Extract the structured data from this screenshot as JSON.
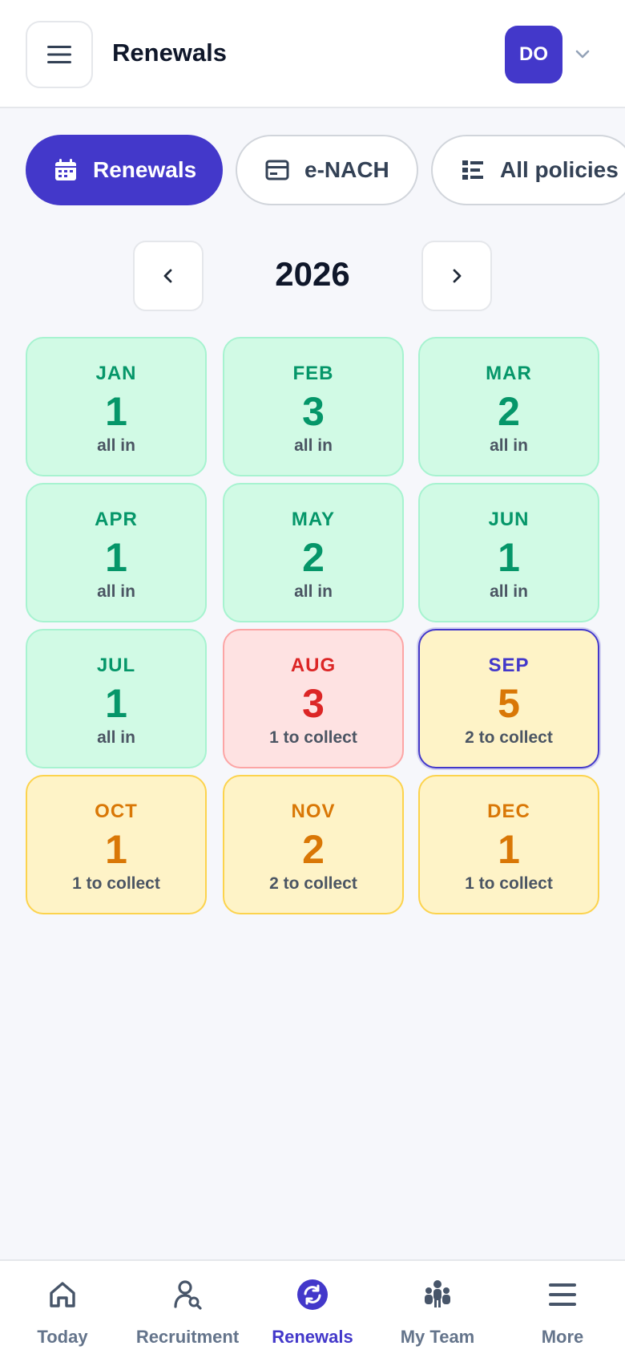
{
  "header": {
    "title": "Renewals",
    "avatar_initials": "DO"
  },
  "tabs": [
    {
      "label": "Renewals",
      "icon": "calendar-icon",
      "active": true
    },
    {
      "label": "e-NACH",
      "icon": "wallet-icon",
      "active": false
    },
    {
      "label": "All policies",
      "icon": "list-icon",
      "active": false
    }
  ],
  "year": "2026",
  "months": [
    {
      "name": "JAN",
      "count": "1",
      "status": "all in",
      "state": "green"
    },
    {
      "name": "FEB",
      "count": "3",
      "status": "all in",
      "state": "green"
    },
    {
      "name": "MAR",
      "count": "2",
      "status": "all in",
      "state": "green"
    },
    {
      "name": "APR",
      "count": "1",
      "status": "all in",
      "state": "green"
    },
    {
      "name": "MAY",
      "count": "2",
      "status": "all in",
      "state": "green"
    },
    {
      "name": "JUN",
      "count": "1",
      "status": "all in",
      "state": "green"
    },
    {
      "name": "JUL",
      "count": "1",
      "status": "all in",
      "state": "green"
    },
    {
      "name": "AUG",
      "count": "3",
      "status": "1 to collect",
      "state": "red"
    },
    {
      "name": "SEP",
      "count": "5",
      "status": "2 to collect",
      "state": "amber",
      "selected": true
    },
    {
      "name": "OCT",
      "count": "1",
      "status": "1 to collect",
      "state": "amber"
    },
    {
      "name": "NOV",
      "count": "2",
      "status": "2 to collect",
      "state": "amber"
    },
    {
      "name": "DEC",
      "count": "1",
      "status": "1 to collect",
      "state": "amber"
    }
  ],
  "bottom_nav": [
    {
      "label": "Today",
      "icon": "home-icon",
      "active": false
    },
    {
      "label": "Recruitment",
      "icon": "user-search-icon",
      "active": false
    },
    {
      "label": "Renewals",
      "icon": "renew-icon",
      "active": true
    },
    {
      "label": "My Team",
      "icon": "team-icon",
      "active": false
    },
    {
      "label": "More",
      "icon": "menu-icon",
      "active": false
    }
  ],
  "colors": {
    "accent": "#4338ca",
    "ok": "#059669",
    "overdue": "#dc2626",
    "pending": "#d97706"
  }
}
